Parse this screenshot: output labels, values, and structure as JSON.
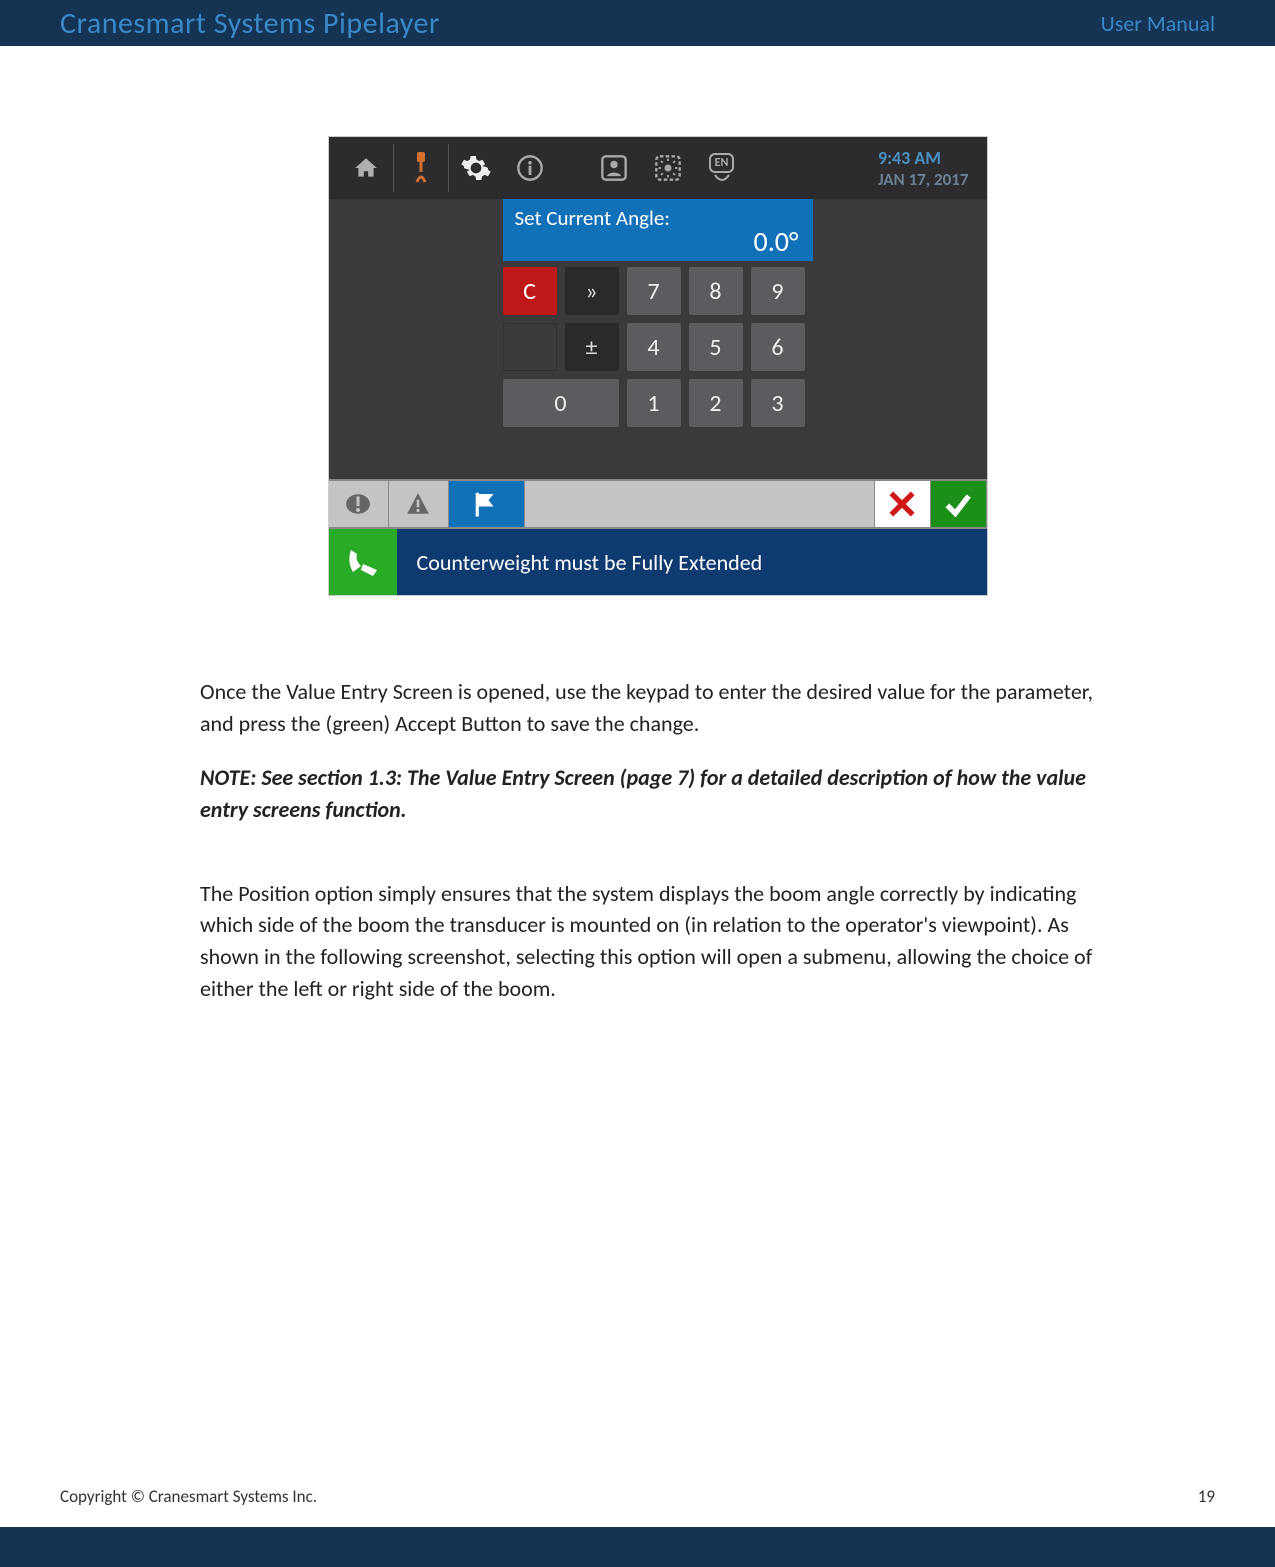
{
  "header": {
    "title": "Cranesmart Systems Pipelayer",
    "right": "User Manual"
  },
  "footer": {
    "copyright": "Copyright © Cranesmart Systems Inc.",
    "page_number": "19"
  },
  "hmi": {
    "time": "9:43 AM",
    "date": "JAN 17, 2017",
    "angle_label": "Set Current Angle:",
    "angle_value": "0.0°",
    "keys": {
      "c": "C",
      "bksp": "»",
      "k7": "7",
      "k8": "8",
      "k9": "9",
      "pm": "±",
      "k4": "4",
      "k5": "5",
      "k6": "6",
      "k0": "0",
      "k1": "1",
      "k2": "2",
      "k3": "3"
    },
    "tabs": {
      "cancel": "✕",
      "ok": "✓"
    },
    "message": "Counterweight must be Fully Extended",
    "lang": "EN"
  },
  "body": {
    "p1": "Once the Value Entry Screen is opened, use the keypad to enter the desired value for the parameter, and press the (green) Accept Button to save the change.",
    "note": "NOTE: See section 1.3: The Value Entry Screen (page 7) for a detailed description of how the value entry screens function.",
    "p2": "The Position option simply ensures that the system displays the boom angle correctly by indicating which side of the boom the transducer is mounted on (in relation to the operator's viewpoint).  As shown in the following screenshot, selecting this option will open a submenu, allowing the choice of either the left or right side of the boom."
  }
}
